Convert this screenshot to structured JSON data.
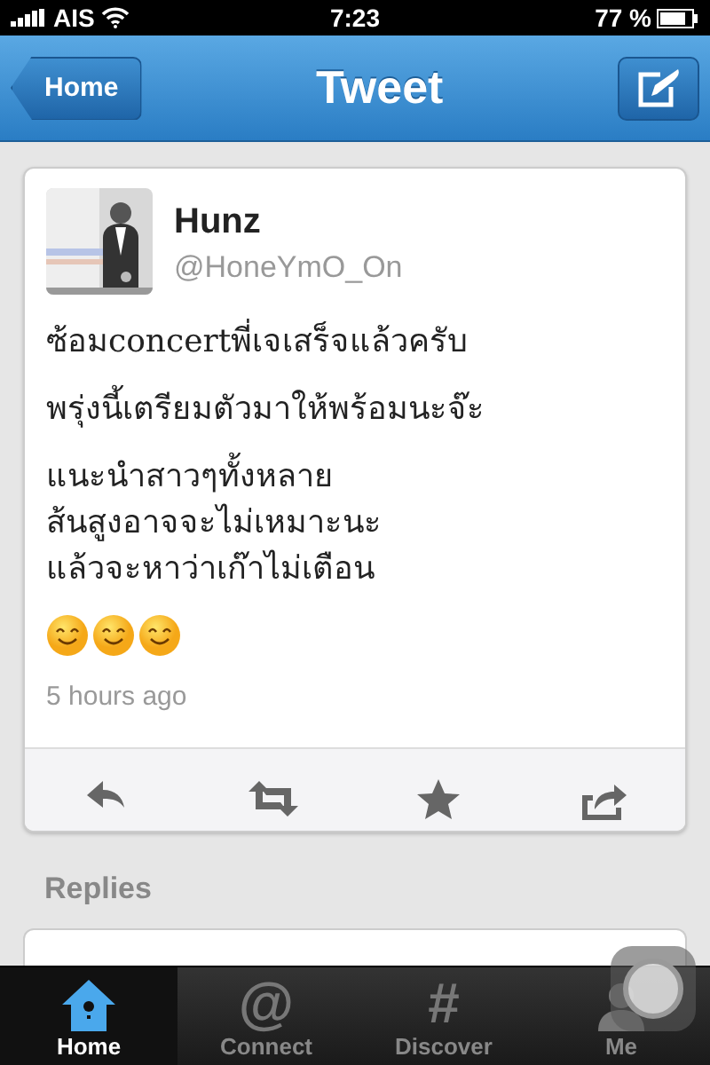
{
  "status_bar": {
    "carrier": "AIS",
    "time": "7:23",
    "battery": "77 %"
  },
  "nav_bar": {
    "back": "Home",
    "title": "Tweet"
  },
  "tweet": {
    "name": "Hunz",
    "handle": "@HoneYmO_On",
    "paragraphs": [
      [
        "ซ้อมconcertพี่เจเสร็จแล้วครับ"
      ],
      [
        "พรุ่งนี้เตรียมตัวมาให้พร้อมนะจ๊ะ"
      ],
      [
        "แนะนำสาวๆทั้งหลาย",
        "ส้นสูงอาจจะไม่เหมาะนะ",
        "แล้วจะหาว่าเก๊าไม่เตือน"
      ]
    ],
    "emoji": [
      {
        "kind": "smile"
      },
      {
        "kind": "smile"
      },
      {
        "kind": "smile"
      }
    ],
    "time": "5 hours ago",
    "actions": [
      {
        "kind": "reply"
      },
      {
        "kind": "retweet"
      },
      {
        "kind": "favorite"
      },
      {
        "kind": "share"
      }
    ]
  },
  "replies_heading": "Replies",
  "tab_bar": [
    {
      "kind": "home",
      "label": "Home",
      "selected": true
    },
    {
      "kind": "glyph",
      "glyph": "@",
      "label": "Connect",
      "selected": false
    },
    {
      "kind": "glyph",
      "glyph": "#",
      "label": "Discover",
      "selected": false
    },
    {
      "kind": "person",
      "label": "Me",
      "selected": false
    }
  ]
}
